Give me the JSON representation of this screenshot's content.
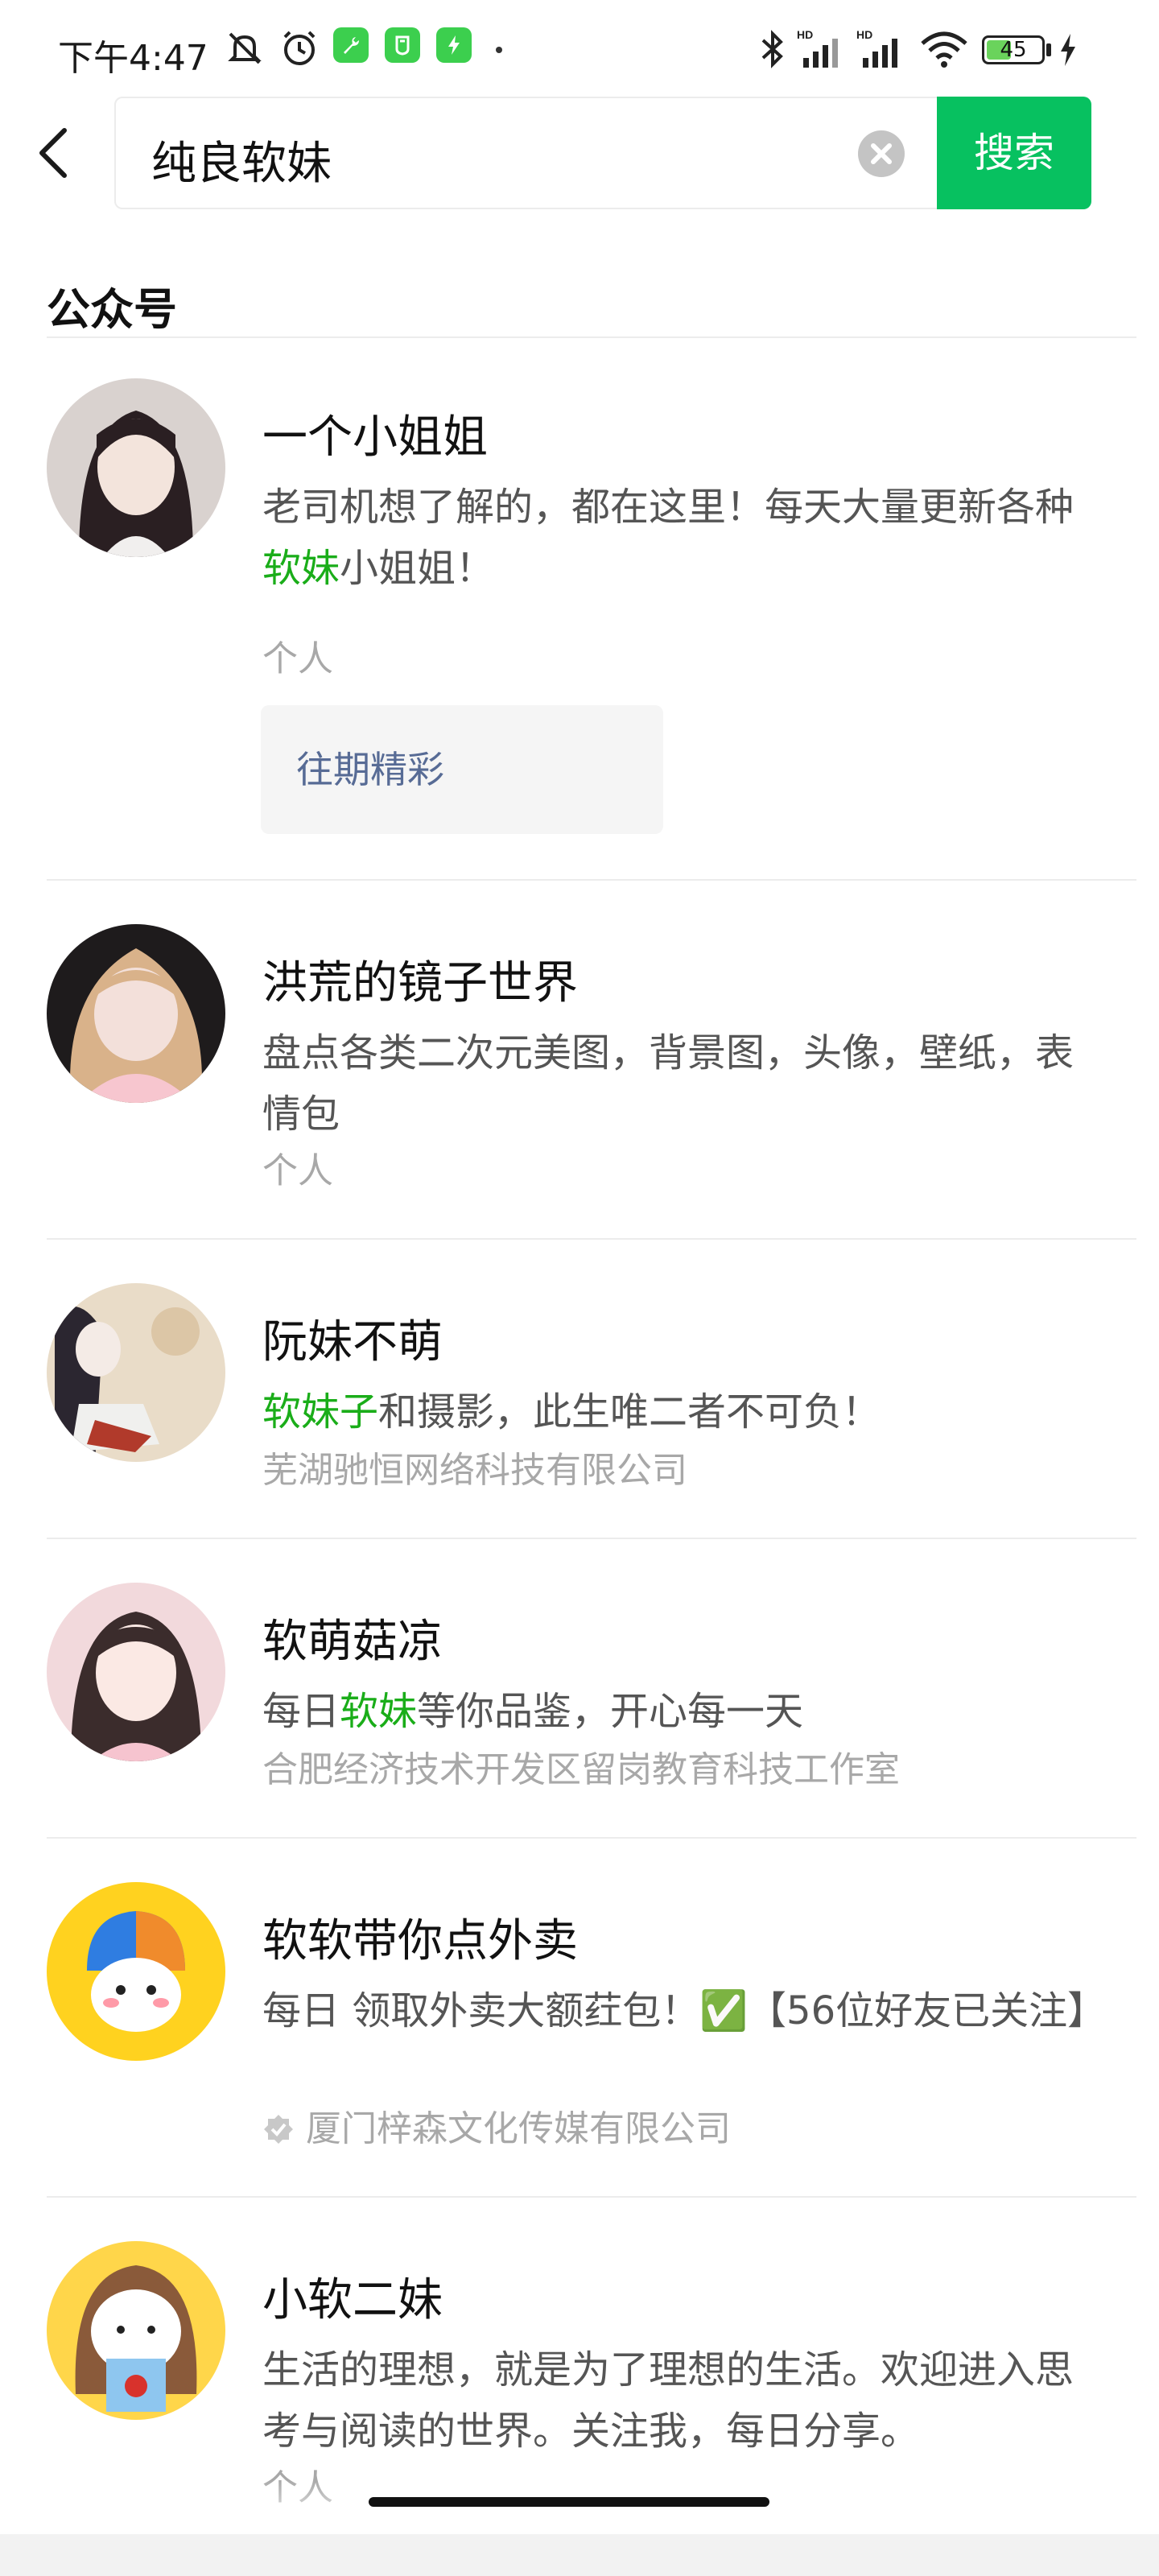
{
  "status_bar": {
    "time": "下午4:47",
    "battery_level": 45,
    "battery_label": "45",
    "icons": [
      "mute-icon",
      "alarm-icon",
      "wrench-app-icon",
      "shield-app-icon",
      "bolt-app-icon",
      "dot-icon",
      "bluetooth-icon",
      "signal-hd-icon",
      "signal-hd-icon",
      "wifi-icon",
      "battery-icon",
      "charging-icon"
    ]
  },
  "search": {
    "value": "纯良软妹",
    "button_label": "搜索"
  },
  "section": {
    "title": "公众号"
  },
  "results": [
    {
      "name": "一个小姐姐",
      "desc_parts": [
        "老司机想了解的，都在这里！每天大量更新各种",
        "软妹",
        "小姐姐！"
      ],
      "owner": "个人",
      "past_label": "往期精彩",
      "avatar_colors": [
        "#d9d2cf",
        "#2a1f22"
      ]
    },
    {
      "name": "洪荒的镜子世界",
      "desc_parts": [
        "盘点各类二次元美图，背景图，头像，壁纸，表情包"
      ],
      "owner": "个人",
      "avatar_colors": [
        "#f3e0da",
        "#d9b28a"
      ]
    },
    {
      "name": "阮妹不萌",
      "desc_parts": [
        "",
        "软妹子",
        "和摄影，此生唯二者不可负！"
      ],
      "owner": "芜湖驰恒网络科技有限公司",
      "avatar_colors": [
        "#e9dcc8",
        "#2b2630"
      ]
    },
    {
      "name": "软萌菇凉",
      "desc_parts": [
        "每日",
        "软妹",
        "等你品鉴，开心每一天"
      ],
      "owner": "合肥经济技术开发区留岗教育科技工作室",
      "avatar_colors": [
        "#f2d9dc",
        "#3b2c2c"
      ]
    },
    {
      "name": "软软带你点外卖",
      "desc_parts": [
        "每日 领取外卖大额荭包！✅【56位好友已关注】"
      ],
      "owner": "厦门梓森文化传媒有限公司",
      "verified": true,
      "avatar_colors": [
        "#ffd21f",
        "#2f7de1"
      ]
    },
    {
      "name": "小软二妹",
      "desc_parts": [
        "生活的理想，就是为了理想的生活。欢迎进入思考与阅读的世界。关注我，每日分享。"
      ],
      "owner": "个人",
      "avatar_colors": [
        "#ffd64a",
        "#8a5a3a"
      ]
    }
  ],
  "colors": {
    "accent": "#07c160",
    "highlight": "#1aad19",
    "link": "#576b95"
  }
}
